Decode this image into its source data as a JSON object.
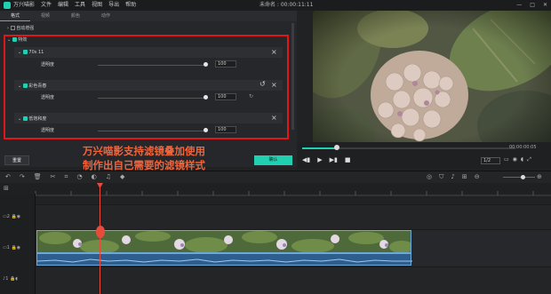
{
  "app": {
    "title": "万兴喵影",
    "menu": [
      "文件",
      "编辑",
      "工具",
      "视图",
      "导出",
      "帮助"
    ],
    "project": "未命名 : 00:00:11:11",
    "window_controls": [
      "minimize-icon",
      "maximize-icon",
      "close-icon"
    ]
  },
  "left_panel": {
    "tabs": [
      "格式",
      "视频",
      "颜色",
      "动作"
    ],
    "auto_enhance": "自动增强",
    "filter_section": "特效",
    "filters": [
      {
        "name": "70s 11",
        "param": "透明度",
        "value": "100"
      },
      {
        "name": "彩色青春",
        "param": "透明度",
        "value": "100"
      },
      {
        "name": "低饱和度",
        "param": "透明度",
        "value": "100"
      }
    ],
    "reset_button": "重置",
    "ok_button": "确认"
  },
  "annotation": {
    "line1": "万兴喵影支持滤镜叠加使用",
    "line2": "制作出自己需要的滤镜样式"
  },
  "player": {
    "timecode": "00:00:00:05",
    "quality": "1/2"
  },
  "timeline": {
    "tracks": [
      "2",
      "1",
      "1"
    ]
  },
  "colors": {
    "accent": "#21d0b0",
    "highlight": "#e0161a",
    "caption": "#f0643c",
    "playhead": "#e84b3c"
  }
}
